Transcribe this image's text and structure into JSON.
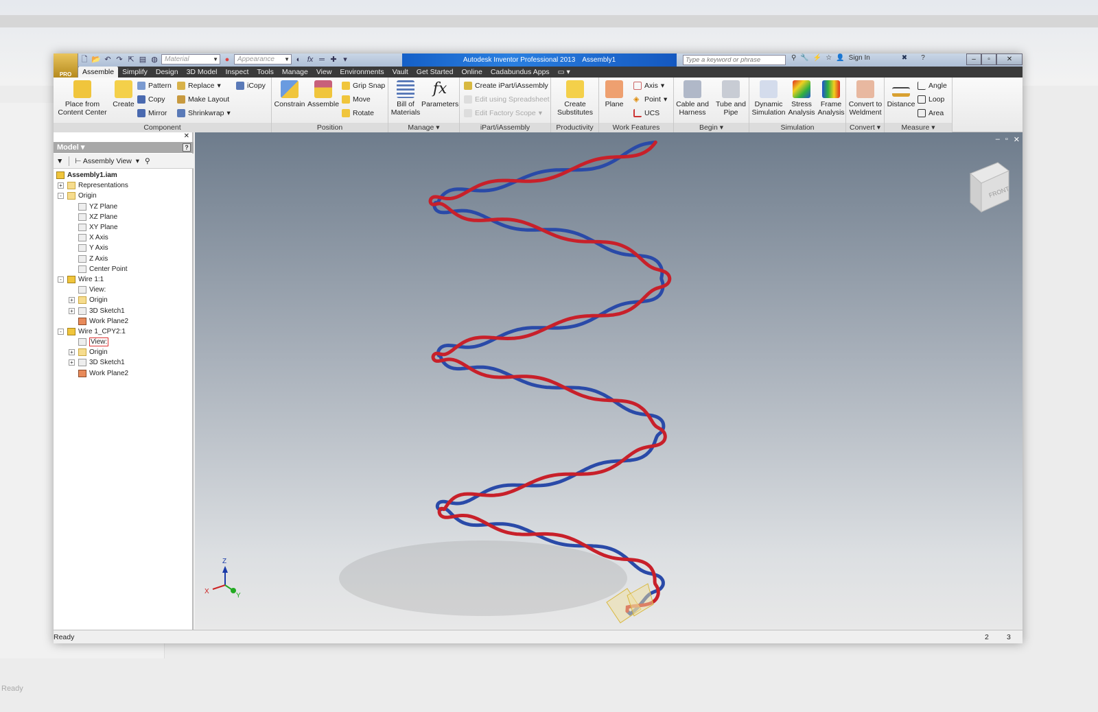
{
  "background": {
    "status": "Ready"
  },
  "titlebar": {
    "app": "Autodesk Inventor Professional 2013",
    "doc": "Assembly1",
    "material": "Material",
    "appearance": "Appearance",
    "search_placeholder": "Type a keyword or phrase",
    "sign_in": "Sign In",
    "app_badge": "PRO"
  },
  "tabs": [
    "Assemble",
    "Simplify",
    "Design",
    "3D Model",
    "Inspect",
    "Tools",
    "Manage",
    "View",
    "Environments",
    "Vault",
    "Get Started",
    "Online",
    "Cadabundus Apps"
  ],
  "ribbon": {
    "component": {
      "label": "Component",
      "place": "Place from Content Center",
      "create": "Create",
      "pattern": "Pattern",
      "copy": "Copy",
      "mirror": "Mirror",
      "replace": "Replace",
      "make_layout": "Make Layout",
      "shrinkwrap": "Shrinkwrap",
      "icopy": "iCopy"
    },
    "position": {
      "label": "Position",
      "constrain": "Constrain",
      "assemble": "Assemble",
      "grip_snap": "Grip Snap",
      "move": "Move",
      "rotate": "Rotate"
    },
    "manage": {
      "label": "Manage",
      "bom": "Bill of Materials",
      "parameters": "Parameters"
    },
    "ipart": {
      "label": "iPart/iAssembly",
      "create": "Create iPart/iAssembly",
      "edit_sheet": "Edit using Spreadsheet",
      "edit_scope": "Edit Factory Scope"
    },
    "productivity": {
      "label": "Productivity",
      "create_subs": "Create Substitutes"
    },
    "work": {
      "label": "Work Features",
      "plane": "Plane",
      "axis": "Axis",
      "point": "Point",
      "ucs": "UCS"
    },
    "begin": {
      "label": "Begin",
      "cable": "Cable and Harness",
      "tube": "Tube and Pipe"
    },
    "simulation": {
      "label": "Simulation",
      "dynamic": "Dynamic Simulation",
      "stress": "Stress Analysis",
      "frame": "Frame Analysis"
    },
    "convert": {
      "label": "Convert",
      "weldment": "Convert to Weldment"
    },
    "measure": {
      "label": "Measure",
      "distance": "Distance",
      "angle": "Angle",
      "loop": "Loop",
      "area": "Area"
    }
  },
  "browser": {
    "title": "Model",
    "view": "Assembly View",
    "tree": [
      {
        "label": "Assembly1.iam",
        "level": 0,
        "exp": "",
        "icon": "asm",
        "bold": true
      },
      {
        "label": "Representations",
        "level": 1,
        "exp": "+",
        "icon": "rep"
      },
      {
        "label": "Origin",
        "level": 1,
        "exp": "-",
        "icon": "folder"
      },
      {
        "label": "YZ Plane",
        "level": 2,
        "exp": "",
        "icon": "plane"
      },
      {
        "label": "XZ Plane",
        "level": 2,
        "exp": "",
        "icon": "plane"
      },
      {
        "label": "XY Plane",
        "level": 2,
        "exp": "",
        "icon": "plane"
      },
      {
        "label": "X Axis",
        "level": 2,
        "exp": "",
        "icon": "axis"
      },
      {
        "label": "Y Axis",
        "level": 2,
        "exp": "",
        "icon": "axis"
      },
      {
        "label": "Z Axis",
        "level": 2,
        "exp": "",
        "icon": "axis"
      },
      {
        "label": "Center Point",
        "level": 2,
        "exp": "",
        "icon": "point"
      },
      {
        "label": "Wire 1:1",
        "level": 1,
        "exp": "-",
        "icon": "asm"
      },
      {
        "label": "View:",
        "level": 2,
        "exp": "",
        "icon": "view"
      },
      {
        "label": "Origin",
        "level": 2,
        "exp": "+",
        "icon": "folder"
      },
      {
        "label": "3D Sketch1",
        "level": 2,
        "exp": "+",
        "icon": "sketch"
      },
      {
        "label": "Work Plane2",
        "level": 2,
        "exp": "",
        "icon": "wp"
      },
      {
        "label": "Wire 1_CPY2:1",
        "level": 1,
        "exp": "-",
        "icon": "asm"
      },
      {
        "label": "View:",
        "level": 2,
        "exp": "",
        "icon": "view",
        "selected": true
      },
      {
        "label": "Origin",
        "level": 2,
        "exp": "+",
        "icon": "folder"
      },
      {
        "label": "3D Sketch1",
        "level": 2,
        "exp": "+",
        "icon": "sketch"
      },
      {
        "label": "Work Plane2",
        "level": 2,
        "exp": "",
        "icon": "wp"
      }
    ]
  },
  "viewcube": {
    "face": "FRONT"
  },
  "triad": {
    "x": "X",
    "y": "Y",
    "z": "Z"
  },
  "colors": {
    "wire_red": "#c8202a",
    "wire_blue": "#2a4aa8"
  },
  "status": {
    "text": "Ready",
    "count1": "2",
    "count2": "3"
  }
}
